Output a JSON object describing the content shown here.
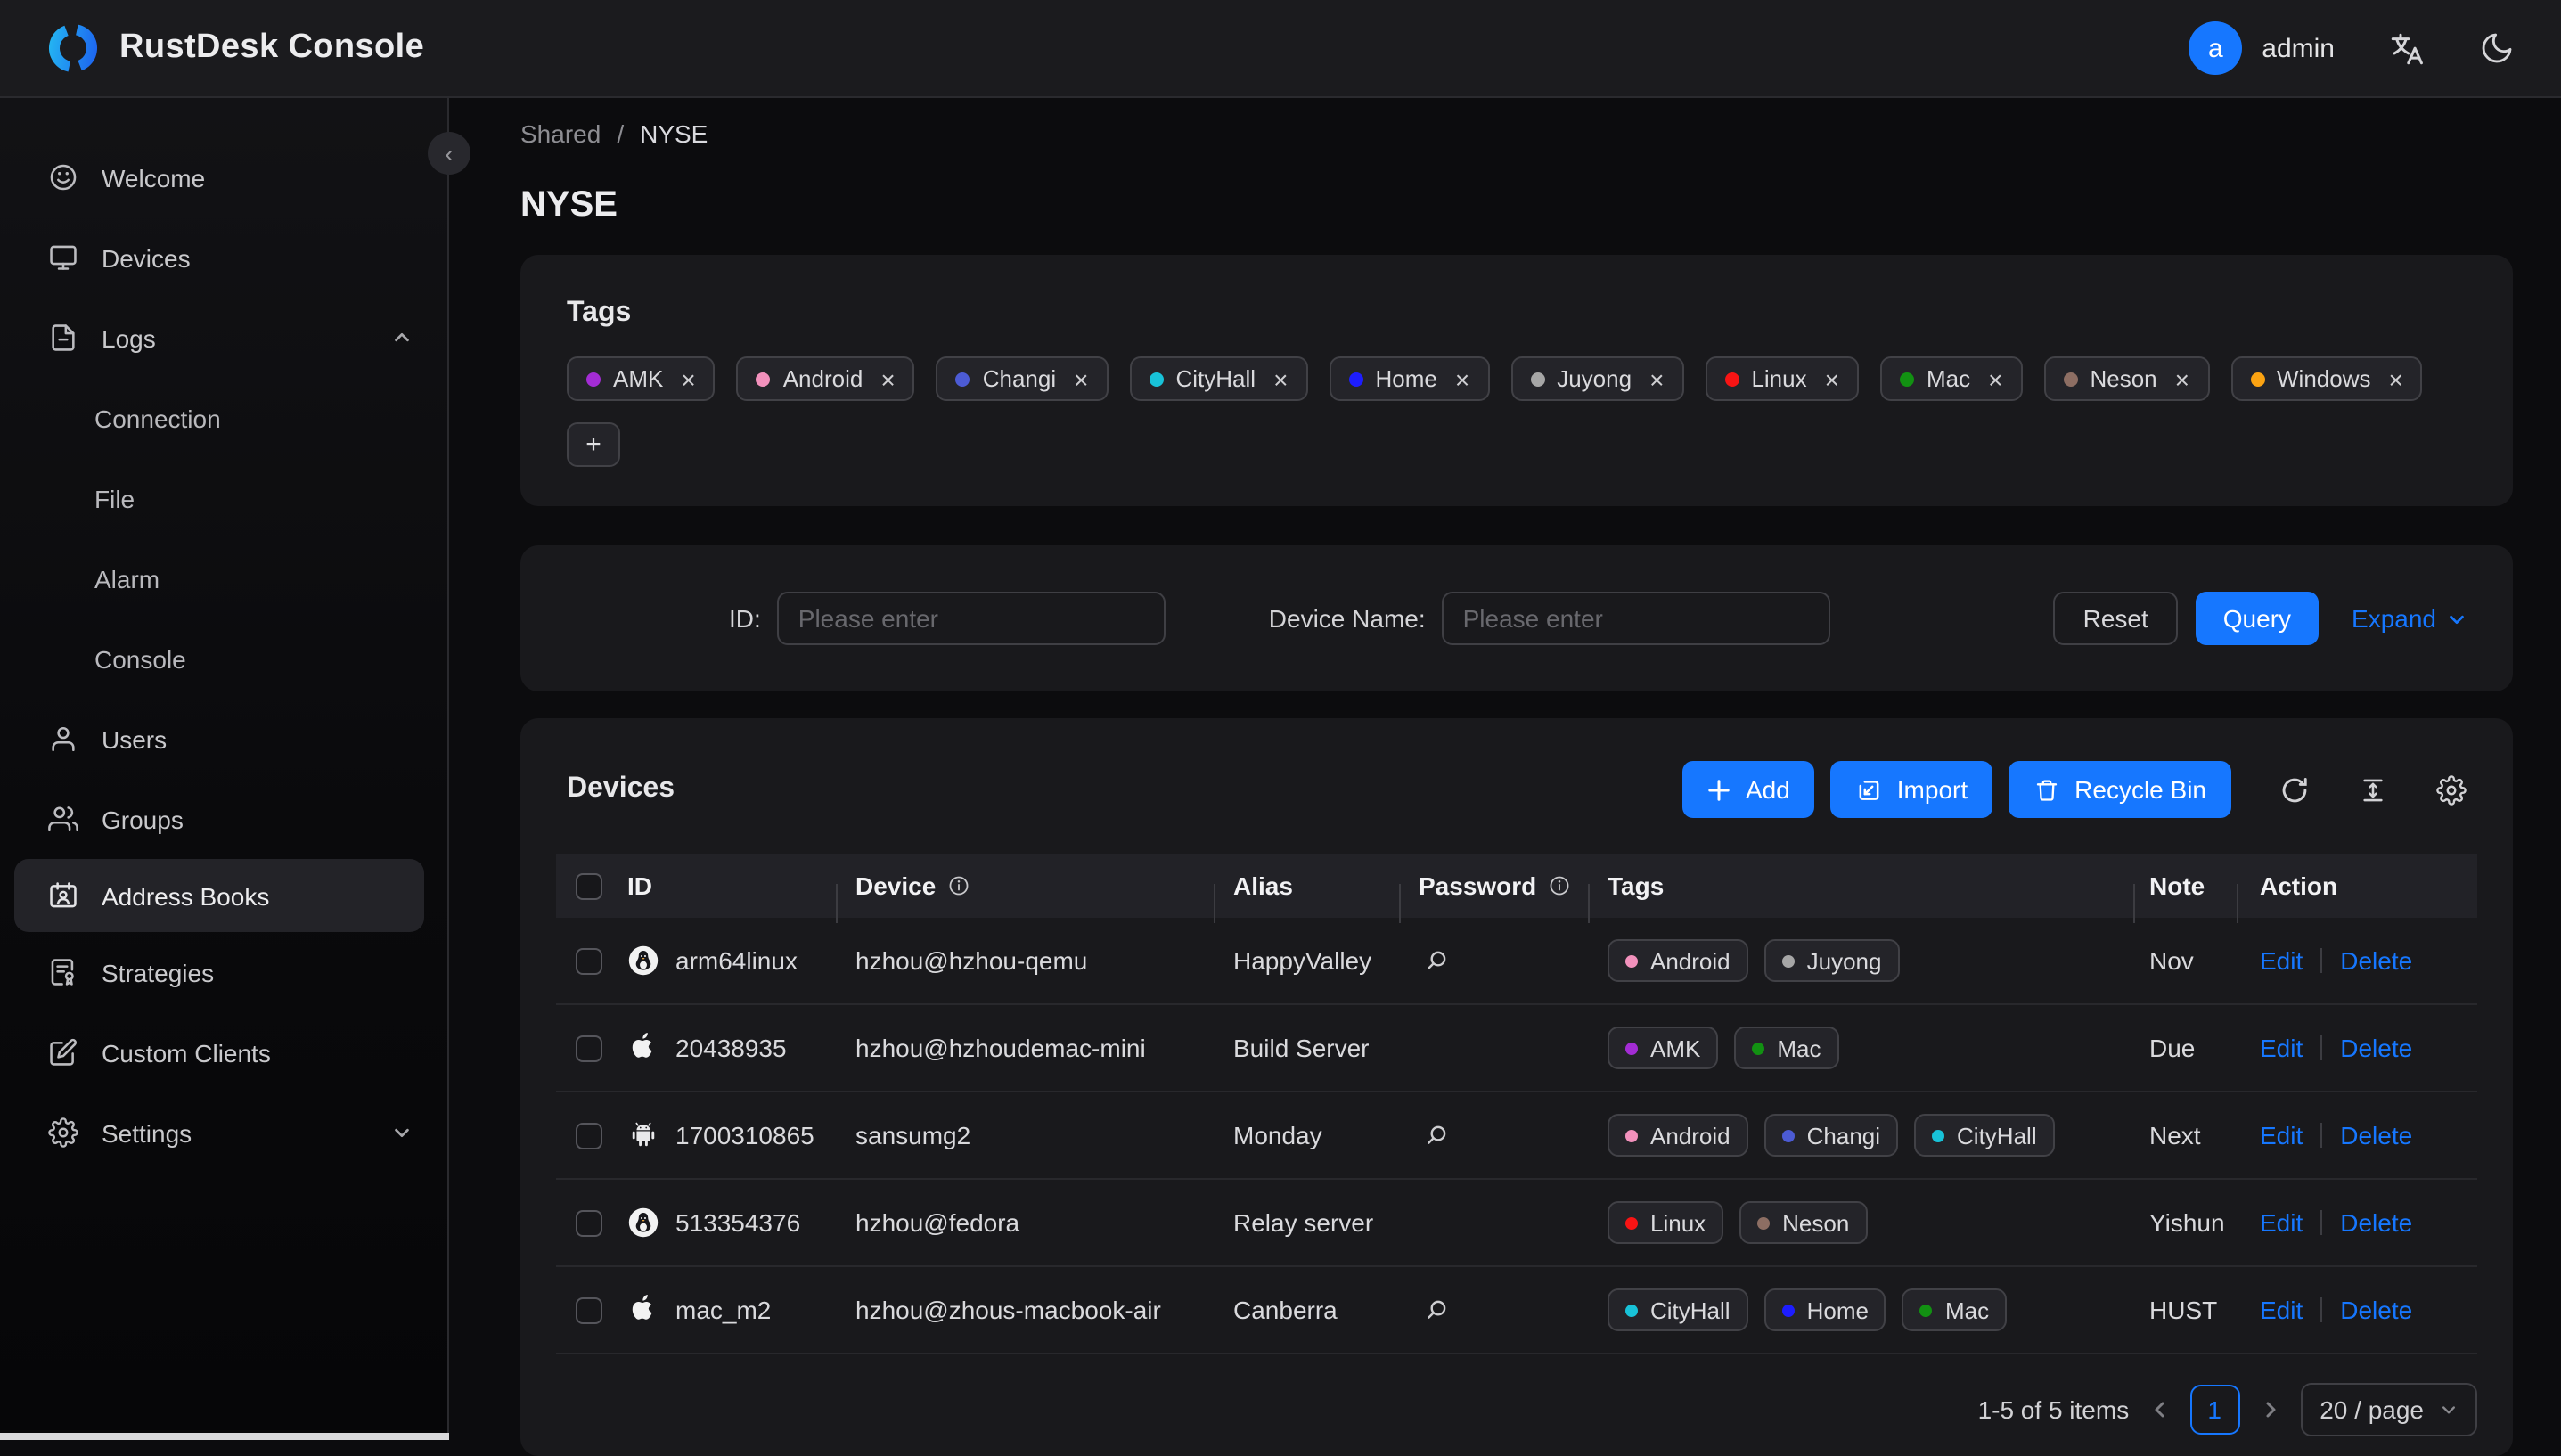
{
  "header": {
    "app_title": "RustDesk Console",
    "user": {
      "avatar_letter": "a",
      "name": "admin"
    },
    "icons": [
      "translate-icon",
      "moon-icon"
    ]
  },
  "sidebar": {
    "items": [
      {
        "label": "Welcome",
        "icon": "smiley-icon"
      },
      {
        "label": "Devices",
        "icon": "monitor-icon"
      },
      {
        "label": "Logs",
        "icon": "file-icon",
        "expanded": true,
        "children": [
          "Connection",
          "File",
          "Alarm",
          "Console"
        ]
      },
      {
        "label": "Users",
        "icon": "user-icon"
      },
      {
        "label": "Groups",
        "icon": "users-icon"
      },
      {
        "label": "Address Books",
        "icon": "contact-card-icon",
        "active": true
      },
      {
        "label": "Strategies",
        "icon": "document-seal-icon"
      },
      {
        "label": "Custom Clients",
        "icon": "edit-square-icon"
      },
      {
        "label": "Settings",
        "icon": "gear-icon",
        "collapsed": true
      }
    ]
  },
  "breadcrumb": {
    "parent": "Shared",
    "separator": "/",
    "current": "NYSE"
  },
  "page_title": "NYSE",
  "tags_card": {
    "title": "Tags",
    "add_button": "+",
    "tags": [
      {
        "name": "AMK",
        "color": "#a32cd4"
      },
      {
        "name": "Android",
        "color": "#f291bc"
      },
      {
        "name": "Changi",
        "color": "#4c5bd4"
      },
      {
        "name": "CityHall",
        "color": "#18c2d8"
      },
      {
        "name": "Home",
        "color": "#1d1dff"
      },
      {
        "name": "Juyong",
        "color": "#a6a6a6"
      },
      {
        "name": "Linux",
        "color": "#f81414"
      },
      {
        "name": "Mac",
        "color": "#129112"
      },
      {
        "name": "Neson",
        "color": "#8d6e63"
      },
      {
        "name": "Windows",
        "color": "#fba312"
      }
    ]
  },
  "filter_card": {
    "id_label": "ID:",
    "id_placeholder": "Please enter",
    "device_name_label": "Device Name:",
    "device_name_placeholder": "Please enter",
    "reset_label": "Reset",
    "query_label": "Query",
    "expand_label": "Expand"
  },
  "devices_card": {
    "title": "Devices",
    "buttons": {
      "add": "Add",
      "import": "Import",
      "recycle_bin": "Recycle Bin"
    },
    "table": {
      "columns": [
        "ID",
        "Device",
        "Alias",
        "Password",
        "Tags",
        "Note",
        "Action"
      ],
      "action_labels": {
        "edit": "Edit",
        "delete": "Delete"
      },
      "rows": [
        {
          "os": "linux",
          "id": "arm64linux",
          "device": "hzhou@hzhou-qemu",
          "alias": "HappyValley",
          "has_password": true,
          "tags": [
            "Android",
            "Juyong"
          ],
          "note": "Nov"
        },
        {
          "os": "apple",
          "id": "20438935",
          "device": "hzhou@hzhoudemac-mini",
          "alias": "Build Server",
          "has_password": false,
          "tags": [
            "AMK",
            "Mac"
          ],
          "note": "Due"
        },
        {
          "os": "android",
          "id": "1700310865",
          "device": "sansumg2",
          "alias": "Monday",
          "has_password": true,
          "tags": [
            "Android",
            "Changi",
            "CityHall"
          ],
          "note": "Next"
        },
        {
          "os": "linux",
          "id": "513354376",
          "device": "hzhou@fedora",
          "alias": "Relay server",
          "has_password": false,
          "tags": [
            "Linux",
            "Neson"
          ],
          "note": "Yishun"
        },
        {
          "os": "apple",
          "id": "mac_m2",
          "device": "hzhou@zhous-macbook-air",
          "alias": "Canberra",
          "has_password": true,
          "tags": [
            "CityHall",
            "Home",
            "Mac"
          ],
          "note": "HUST"
        }
      ]
    },
    "pagination": {
      "summary": "1-5 of 5 items",
      "current_page": "1",
      "page_size": "20 / page"
    }
  },
  "colors": {
    "accent": "#1677ff"
  }
}
